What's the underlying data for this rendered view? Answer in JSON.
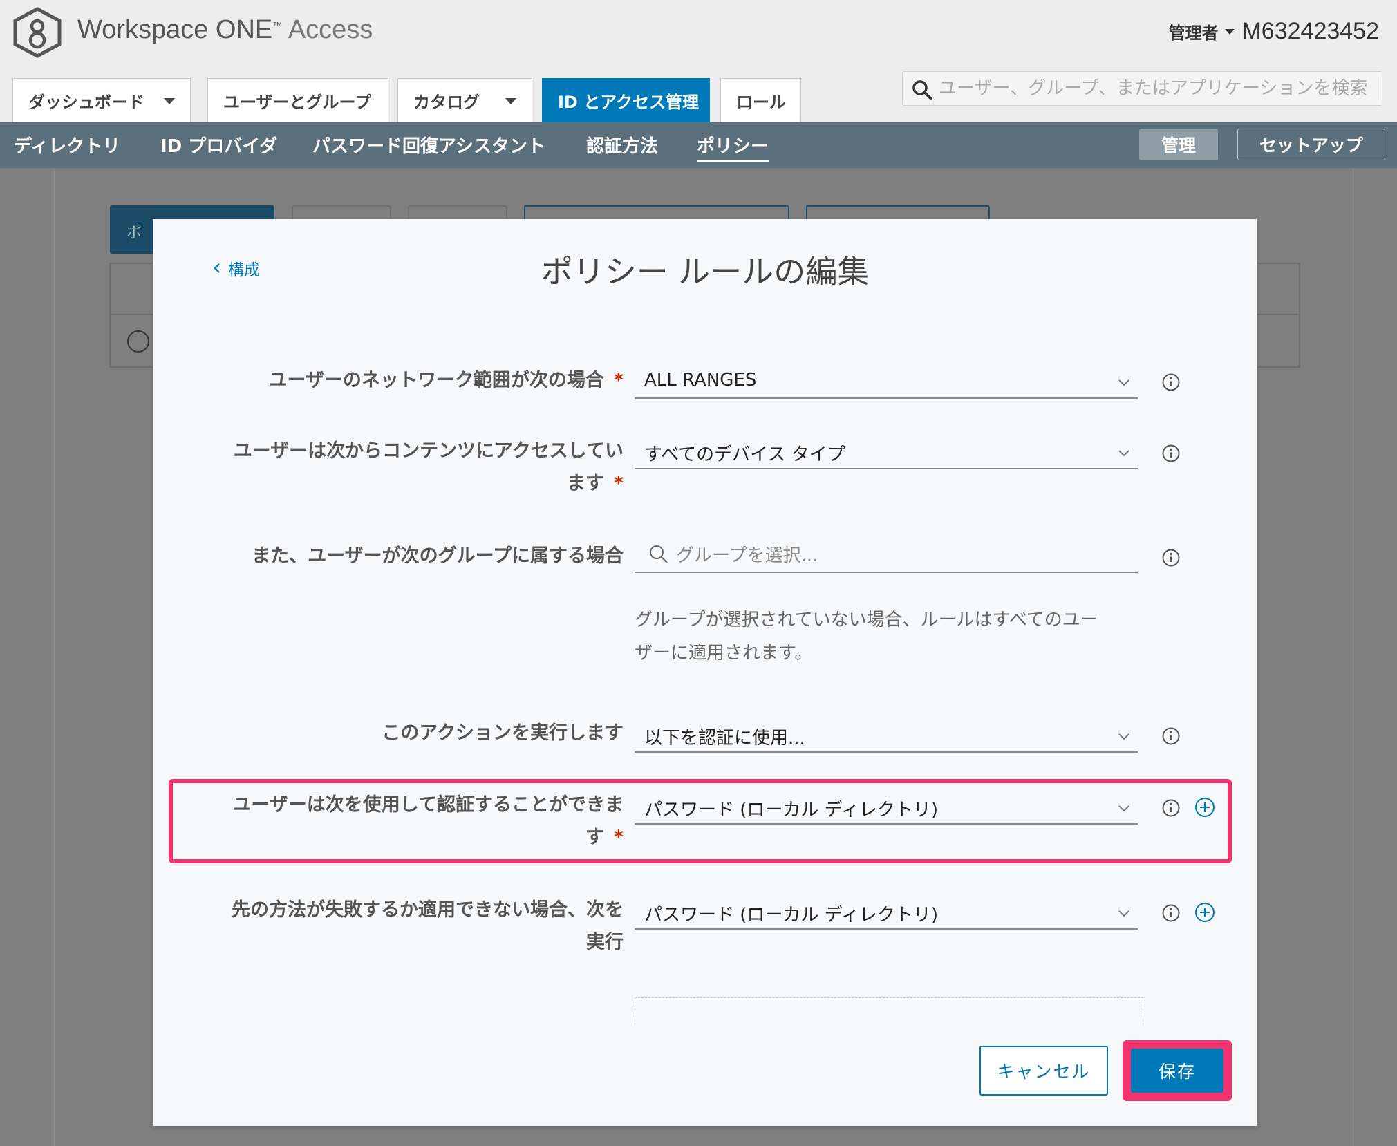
{
  "header": {
    "app_title": "Workspace ONE",
    "app_title_tm": "™",
    "app_title_suffix": "Access",
    "user_role": "管理者",
    "user_id": "M632423452",
    "search_placeholder": "ユーザー、グループ、またはアプリケーションを検索"
  },
  "main_tabs": [
    {
      "label": "ダッシュボード",
      "dropdown": true
    },
    {
      "label": "ユーザーとグループ",
      "dropdown": false
    },
    {
      "label": "カタログ",
      "dropdown": true
    },
    {
      "label": "ID とアクセス管理",
      "active": true
    },
    {
      "label": "ロール",
      "dropdown": false
    }
  ],
  "subnav": {
    "items": [
      "ディレクトリ",
      "ID プロバイダ",
      "パスワード回復アシスタント",
      "認証方法",
      "ポリシー"
    ],
    "active": "ポリシー",
    "manage_label": "管理",
    "setup_label": "セットアップ"
  },
  "background": {
    "primary_button_label": "ポ"
  },
  "modal": {
    "back_label": "構成",
    "title": "ポリシー ルールの編集",
    "fields": {
      "network_range": {
        "label": "ユーザーのネットワーク範囲が次の場合",
        "required": "*",
        "value": "ALL RANGES"
      },
      "device_type": {
        "label_line1": "ユーザーは次からコンテンツにアクセスしてい",
        "label_line2": "ます",
        "required": "*",
        "value": "すべてのデバイス タイプ"
      },
      "group": {
        "label": "また、ユーザーが次のグループに属する場合",
        "placeholder": "グループを選択...",
        "helper_line1": "グループが選択されていない場合、ルールはすべてのユー",
        "helper_line2": "ザーに適用されます。"
      },
      "action": {
        "label": "このアクションを実行します",
        "value": "以下を認証に使用..."
      },
      "auth_method": {
        "label_line1": "ユーザーは次を使用して認証することができま",
        "label_line2": "す",
        "required": "*",
        "value": "パスワード (ローカル ディレクトリ)"
      },
      "fallback_method": {
        "label_line1": "先の方法が失敗するか適用できない場合、次を",
        "label_line2": "実行",
        "value": "パスワード (ローカル ディレクトリ)"
      }
    },
    "cancel_label": "キャンセル",
    "save_label": "保存"
  },
  "colors": {
    "primary": "#0079b8",
    "subnav_bg": "#5c6f7c",
    "highlight": "#f2326f",
    "required": "#c92100"
  },
  "icons": [
    "logo-icon",
    "caret-down-icon",
    "search-icon",
    "chevron-left-icon",
    "chevron-down-icon",
    "info-icon",
    "plus-icon"
  ]
}
